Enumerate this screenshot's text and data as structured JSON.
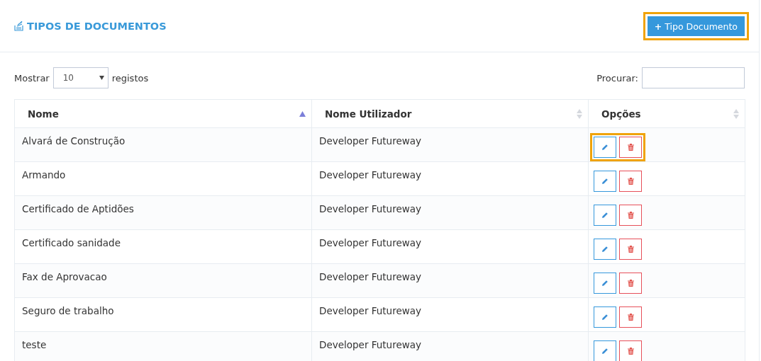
{
  "header": {
    "title": "TIPOS DE DOCUMENTOS",
    "add_button": {
      "icon": "+",
      "label": "Tipo Documento",
      "highlighted": true
    }
  },
  "controls": {
    "show_label": "Mostrar",
    "page_size": "10",
    "records_label": "registos",
    "search_label": "Procurar:"
  },
  "table": {
    "columns": [
      {
        "label": "Nome",
        "sorted": true
      },
      {
        "label": "Nome Utilizador",
        "sorted": false
      },
      {
        "label": "Opções",
        "sorted": false
      }
    ],
    "rows": [
      {
        "name": "Alvará de Construção",
        "user": "Developer Futureway",
        "highlighted": true
      },
      {
        "name": "Armando",
        "user": "Developer Futureway",
        "highlighted": false
      },
      {
        "name": "Certificado de Aptidões",
        "user": "Developer Futureway",
        "highlighted": false
      },
      {
        "name": "Certificado sanidade",
        "user": "Developer Futureway",
        "highlighted": false
      },
      {
        "name": "Fax de Aprovacao",
        "user": "Developer Futureway",
        "highlighted": false
      },
      {
        "name": "Seguro de trabalho",
        "user": "Developer Futureway",
        "highlighted": false
      },
      {
        "name": "teste",
        "user": "Developer Futureway",
        "highlighted": false
      }
    ]
  }
}
